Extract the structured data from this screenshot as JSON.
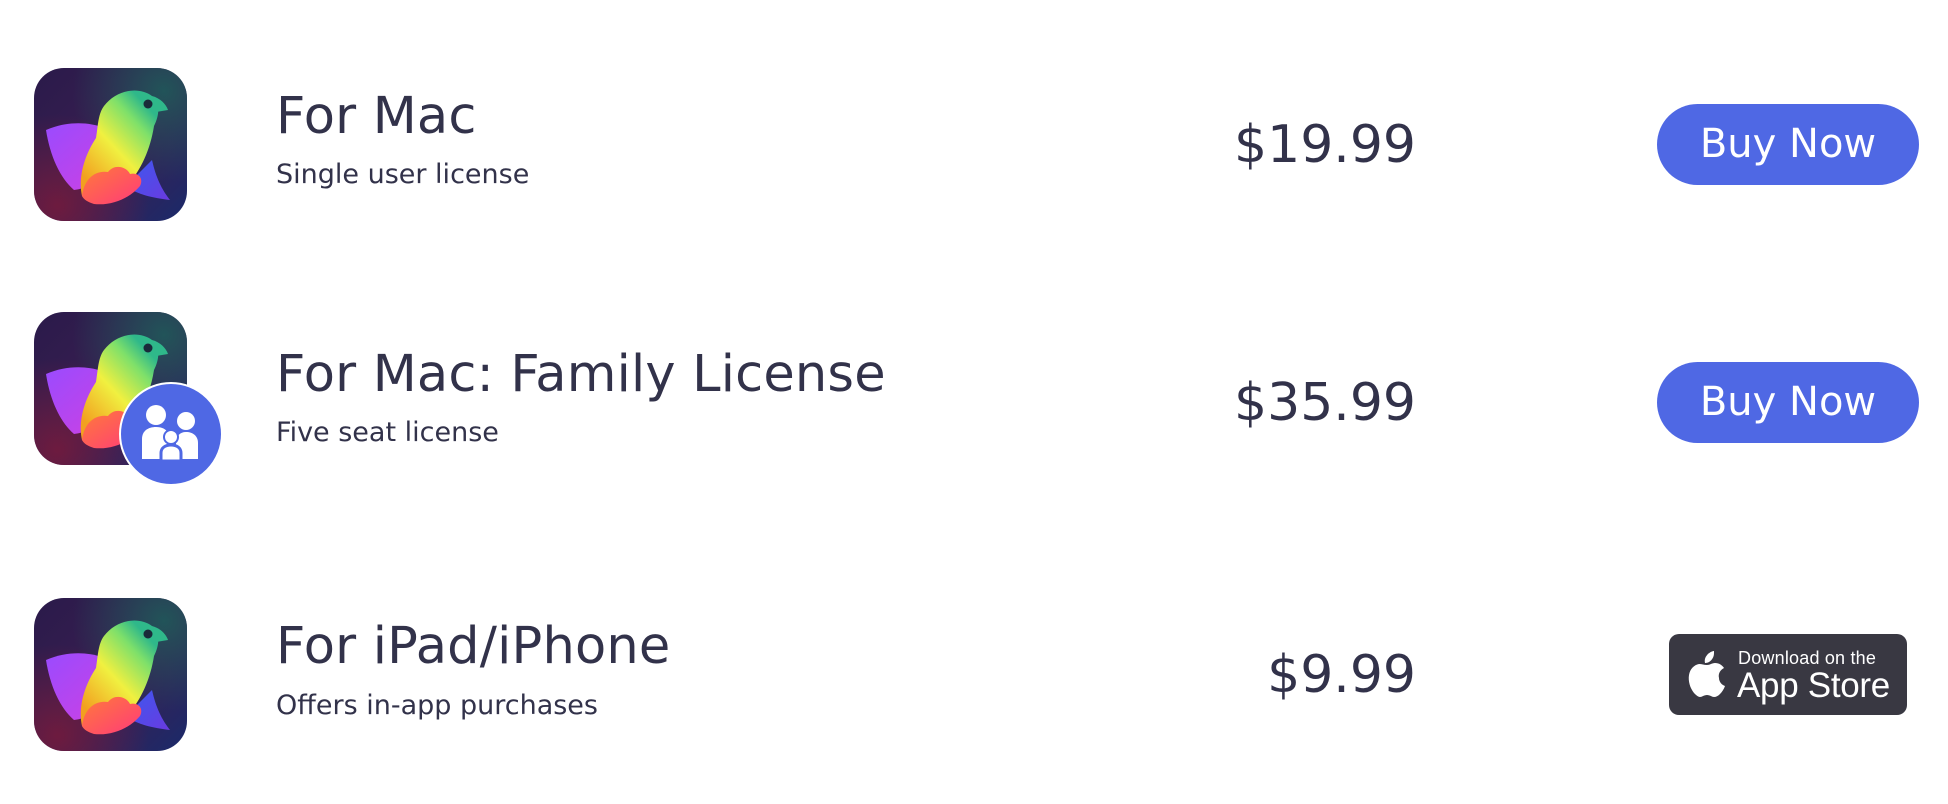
{
  "products": [
    {
      "icon": "bird-app-icon",
      "title": "For Mac",
      "subtitle": "Single user license",
      "price": "$19.99",
      "action": "Buy Now"
    },
    {
      "icon": "bird-app-icon",
      "badge_icon": "family-icon",
      "title": "For Mac: Family License",
      "subtitle": "Five seat license",
      "price": "$35.99",
      "action": "Buy Now"
    },
    {
      "icon": "bird-app-icon",
      "title": "For iPad/iPhone",
      "subtitle": "Offers in-app purchases",
      "price": "$9.99",
      "app_store": {
        "icon": "apple-icon",
        "small_text": "Download on the",
        "large_text": "App Store"
      }
    }
  ],
  "colors": {
    "text": "#32324a",
    "button": "#4f68e4",
    "button_text": "#ffffff",
    "app_store_badge": "#393842"
  }
}
